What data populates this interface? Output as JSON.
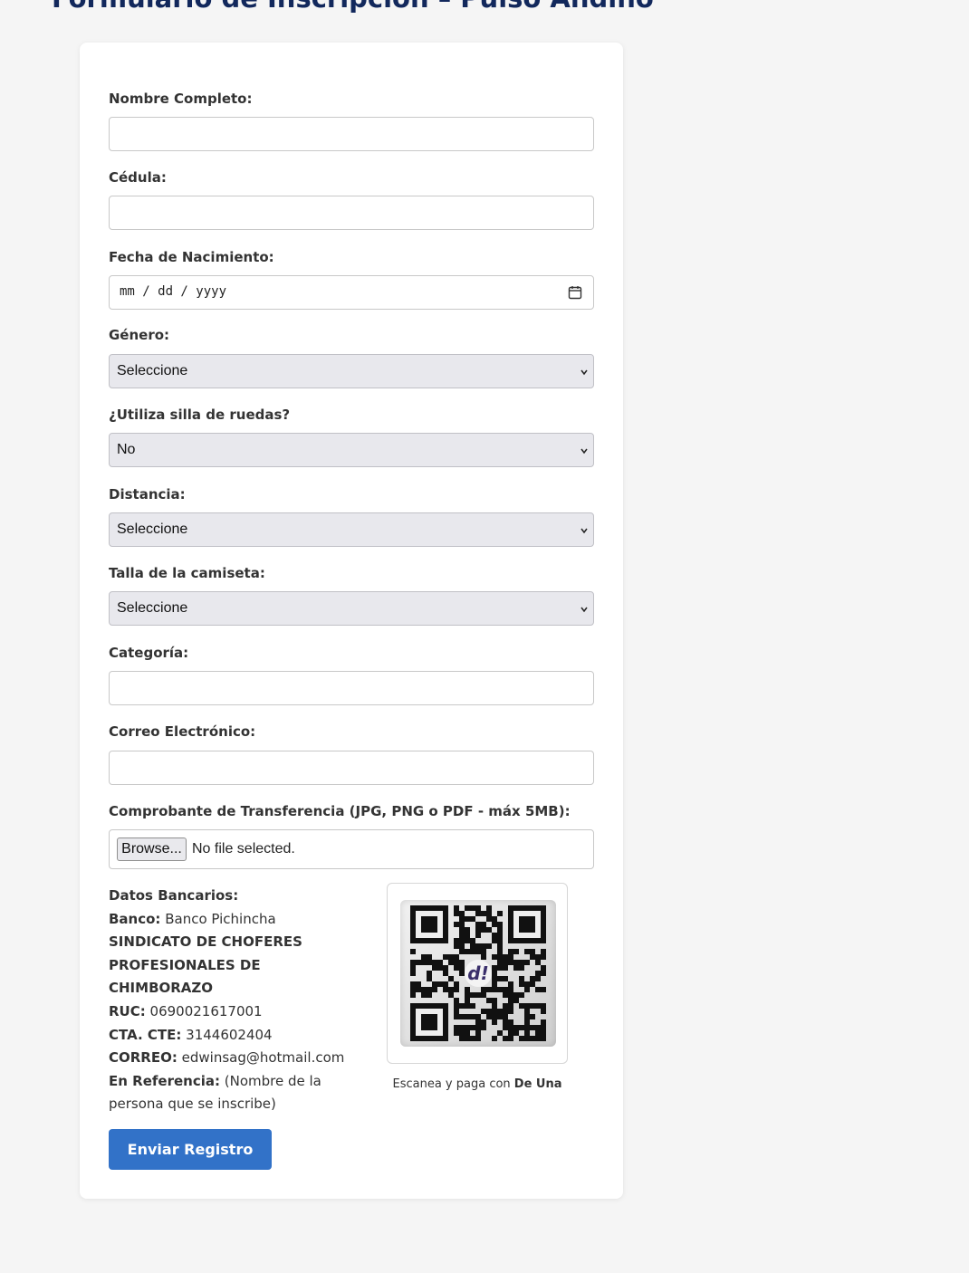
{
  "page": {
    "title": "Formulario de Inscripción – Pulso Andino"
  },
  "form": {
    "nombre": {
      "label": "Nombre Completo:",
      "value": ""
    },
    "cedula": {
      "label": "Cédula:",
      "value": ""
    },
    "fecha": {
      "label": "Fecha de Nacimiento:",
      "placeholder": "mm / dd / yyyy"
    },
    "genero": {
      "label": "Género:",
      "selected": "Seleccione"
    },
    "silla": {
      "label": "¿Utiliza silla de ruedas?",
      "selected": "No"
    },
    "distancia": {
      "label": "Distancia:",
      "selected": "Seleccione"
    },
    "talla": {
      "label": "Talla de la camiseta:",
      "selected": "Seleccione"
    },
    "categoria": {
      "label": "Categoría:",
      "value": ""
    },
    "correo": {
      "label": "Correo Electrónico:",
      "value": ""
    },
    "comprobante": {
      "label": "Comprobante de Transferencia (JPG, PNG o PDF - máx 5MB):",
      "browse_label": "Browse...",
      "status": "No file selected."
    },
    "submit_label": "Enviar Registro"
  },
  "bank": {
    "heading": "Datos Bancarios:",
    "banco_label": "Banco:",
    "banco_value": "Banco Pichincha",
    "holder": "SINDICATO DE CHOFERES PROFESIONALES DE CHIMBORAZO",
    "ruc_label": "RUC:",
    "ruc_value": "0690021617001",
    "cta_label": "CTA. CTE:",
    "cta_value": "3144602404",
    "correo_label": "CORREO:",
    "correo_value": "edwinsag@hotmail.com",
    "ref_label": "En Referencia:",
    "ref_value": "(Nombre de la persona que se inscribe)"
  },
  "qr": {
    "caption_prefix": "Escanea y paga con",
    "caption_brand": "De Una",
    "logo_text": "d!"
  }
}
